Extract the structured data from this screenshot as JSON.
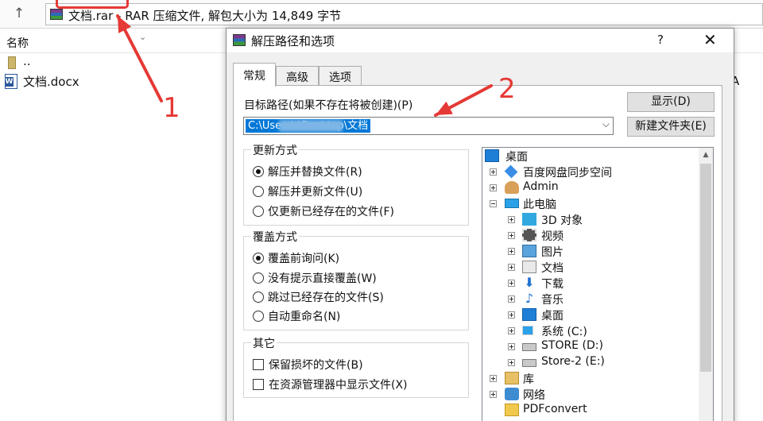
{
  "winrar": {
    "address_text": "文档.rar - RAR 压缩文件, 解包大小为 14,849 字节",
    "column_name": "名称",
    "files": [
      {
        "label": ".."
      },
      {
        "label": "文档.docx"
      }
    ],
    "truncated_text": "A"
  },
  "annotations": {
    "num1": "1",
    "num2": "2",
    "color": "#e53935"
  },
  "dialog": {
    "title": "解压路径和选项",
    "help": "?",
    "close": "✕",
    "tabs": [
      {
        "label": "常规",
        "active": true
      },
      {
        "label": "高级",
        "active": false
      },
      {
        "label": "选项",
        "active": false
      }
    ],
    "path_label": "目标路径(如果不存在将被创建)(P)",
    "path_value": "C:\\Users\\    \\Desktop\\文档",
    "buttons": {
      "show": "显示(D)",
      "new_folder": "新建文件夹(E)"
    },
    "update_mode": {
      "legend": "更新方式",
      "options": [
        {
          "label": "解压并替换文件(R)",
          "selected": true
        },
        {
          "label": "解压并更新文件(U)",
          "selected": false
        },
        {
          "label": "仅更新已经存在的文件(F)",
          "selected": false
        }
      ]
    },
    "overwrite_mode": {
      "legend": "覆盖方式",
      "options": [
        {
          "label": "覆盖前询问(K)",
          "selected": true
        },
        {
          "label": "没有提示直接覆盖(W)",
          "selected": false
        },
        {
          "label": "跳过已经存在的文件(S)",
          "selected": false
        },
        {
          "label": "自动重命名(N)",
          "selected": false
        }
      ]
    },
    "misc": {
      "legend": "其它",
      "options": [
        {
          "label": "保留损坏的文件(B)",
          "checked": false
        },
        {
          "label": "在资源管理器中显示文件(X)",
          "checked": false
        }
      ]
    },
    "tree": [
      {
        "label": "桌面",
        "icon": "desktop-icon"
      },
      {
        "label": "百度网盘同步空间",
        "icon": "baidu-netdisk-icon"
      },
      {
        "label": "Admin",
        "icon": "user-icon"
      },
      {
        "label": "此电脑",
        "icon": "this-pc-icon"
      },
      {
        "label": "3D 对象",
        "icon": "3d-objects-icon"
      },
      {
        "label": "视频",
        "icon": "videos-icon"
      },
      {
        "label": "图片",
        "icon": "pictures-icon"
      },
      {
        "label": "文档",
        "icon": "documents-icon"
      },
      {
        "label": "下载",
        "icon": "downloads-icon"
      },
      {
        "label": "音乐",
        "icon": "music-icon"
      },
      {
        "label": "桌面",
        "icon": "desktop-icon"
      },
      {
        "label": "系统 (C:)",
        "icon": "system-drive-icon"
      },
      {
        "label": "STORE (D:)",
        "icon": "drive-icon"
      },
      {
        "label": "Store-2 (E:)",
        "icon": "drive-icon"
      },
      {
        "label": "库",
        "icon": "libraries-icon"
      },
      {
        "label": "网络",
        "icon": "network-icon"
      },
      {
        "label": "PDFconvert",
        "icon": "folder-icon"
      }
    ]
  }
}
